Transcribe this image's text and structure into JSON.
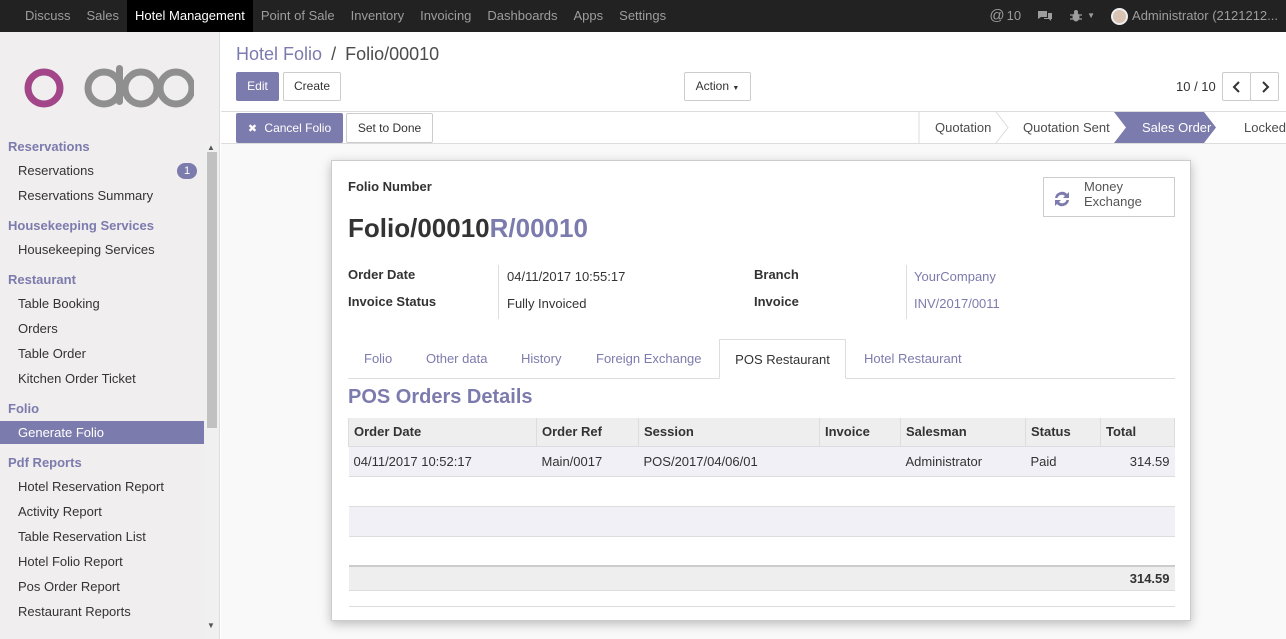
{
  "topbar": {
    "menu": [
      "Discuss",
      "Sales",
      "Hotel Management",
      "Point of Sale",
      "Inventory",
      "Invoicing",
      "Dashboards",
      "Apps",
      "Settings"
    ],
    "active_index": 2,
    "messages_count": "10",
    "user": "Administrator (2121212..."
  },
  "sidebar": {
    "logo_text": "odoo",
    "sections": [
      {
        "title": "Reservations",
        "items": [
          "Reservations",
          "Reservations Summary"
        ],
        "badge": "1"
      },
      {
        "title": "Housekeeping Services",
        "items": [
          "Housekeeping Services"
        ]
      },
      {
        "title": "Restaurant",
        "items": [
          "Table Booking",
          "Orders",
          "Table Order",
          "Kitchen Order Ticket"
        ]
      },
      {
        "title": "Folio",
        "items": [
          "Generate Folio"
        ]
      },
      {
        "title": "Pdf Reports",
        "items": [
          "Hotel Reservation Report",
          "Activity Report",
          "Table Reservation List",
          "Hotel Folio Report",
          "Pos Order Report",
          "Restaurant Reports"
        ]
      }
    ],
    "active_item": "Generate Folio"
  },
  "control_panel": {
    "breadcrumb_parent": "Hotel Folio",
    "breadcrumb_sep": "/",
    "breadcrumb_current": "Folio/00010",
    "edit_label": "Edit",
    "create_label": "Create",
    "action_label": "Action",
    "pager": "10 / 10"
  },
  "statusbar": {
    "cancel_label": "Cancel Folio",
    "done_label": "Set to Done",
    "stages": [
      "Quotation",
      "Quotation Sent",
      "Sales Order",
      "Locked"
    ],
    "active_stage": "Sales Order"
  },
  "form": {
    "folio_number_label": "Folio Number",
    "folio_name": "Folio/00010",
    "folio_ref": "R/00010",
    "money_exchange_label": "Money Exchange",
    "order_date_label": "Order Date",
    "order_date": "04/11/2017 10:55:17",
    "invoice_status_label": "Invoice Status",
    "invoice_status": "Fully Invoiced",
    "branch_label": "Branch",
    "branch": "YourCompany",
    "invoice_label": "Invoice",
    "invoice": "INV/2017/0011"
  },
  "tabs": [
    "Folio",
    "Other data",
    "History",
    "Foreign Exchange",
    "POS Restaurant",
    "Hotel Restaurant"
  ],
  "active_tab": "POS Restaurant",
  "pos": {
    "title": "POS Orders Details",
    "columns": [
      "Order Date",
      "Order Ref",
      "Session",
      "Invoice",
      "Salesman",
      "Status",
      "Total"
    ],
    "rows": [
      {
        "order_date": "04/11/2017 10:52:17",
        "order_ref": "Main/0017",
        "session": "POS/2017/04/06/01",
        "invoice": "",
        "salesman": "Administrator",
        "status": "Paid",
        "total": "314.59"
      }
    ],
    "sum_total": "314.59"
  },
  "colors": {
    "accent": "#7c7bad",
    "topbar": "#222222"
  }
}
